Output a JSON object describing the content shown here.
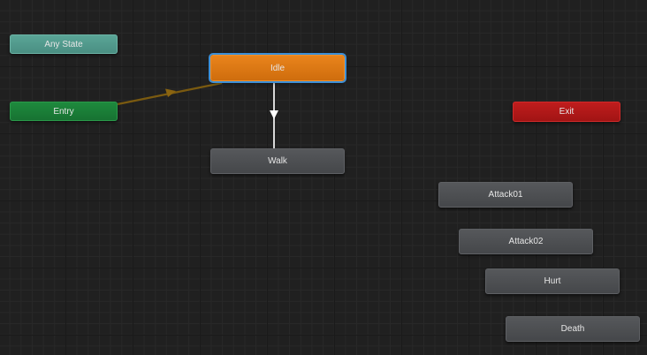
{
  "graph": {
    "nodes": {
      "any_state": "Any State",
      "entry": "Entry",
      "idle": "Idle",
      "walk": "Walk",
      "exit": "Exit",
      "attack01": "Attack01",
      "attack02": "Attack02",
      "hurt": "Hurt",
      "death": "Death"
    },
    "default_state": "Idle",
    "selected_state": "Idle",
    "transitions": [
      {
        "from": "Entry",
        "to": "Idle"
      },
      {
        "from": "Idle",
        "to": "Walk"
      }
    ]
  },
  "colors": {
    "grid_background": "#202020",
    "any_state": "#4f9a8c",
    "entry": "#1a7d37",
    "exit": "#b01818",
    "idle_default": "#de7914",
    "selection_outline": "#3d8fd6",
    "state": "#4c4e51",
    "entry_transition": "#7a5a10",
    "transition": "#d8d8d8"
  },
  "icons": {
    "entry_transition_arrow": "triangle-arrow-icon",
    "idle_walk_transition_arrow": "triangle-down-icon"
  }
}
